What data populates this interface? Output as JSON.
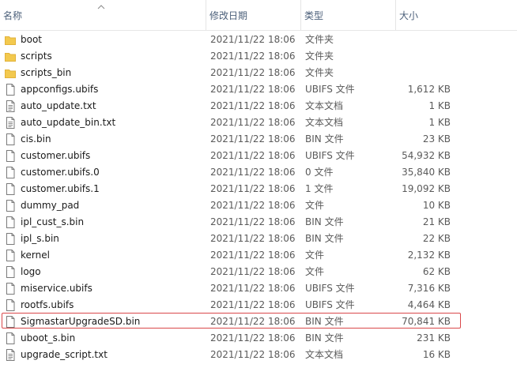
{
  "columns": {
    "name": "名称",
    "date": "修改日期",
    "type": "类型",
    "size": "大小"
  },
  "files": [
    {
      "name": "boot",
      "date": "2021/11/22 18:06",
      "type": "文件夹",
      "size": "",
      "icon": "folder-icon"
    },
    {
      "name": "scripts",
      "date": "2021/11/22 18:06",
      "type": "文件夹",
      "size": "",
      "icon": "folder-icon"
    },
    {
      "name": "scripts_bin",
      "date": "2021/11/22 18:06",
      "type": "文件夹",
      "size": "",
      "icon": "folder-icon"
    },
    {
      "name": "appconfigs.ubifs",
      "date": "2021/11/22 18:06",
      "type": "UBIFS 文件",
      "size": "1,612 KB",
      "icon": "file-icon"
    },
    {
      "name": "auto_update.txt",
      "date": "2021/11/22 18:06",
      "type": "文本文档",
      "size": "1 KB",
      "icon": "text-file-icon"
    },
    {
      "name": "auto_update_bin.txt",
      "date": "2021/11/22 18:06",
      "type": "文本文档",
      "size": "1 KB",
      "icon": "text-file-icon"
    },
    {
      "name": "cis.bin",
      "date": "2021/11/22 18:06",
      "type": "BIN 文件",
      "size": "23 KB",
      "icon": "file-icon"
    },
    {
      "name": "customer.ubifs",
      "date": "2021/11/22 18:06",
      "type": "UBIFS 文件",
      "size": "54,932 KB",
      "icon": "file-icon"
    },
    {
      "name": "customer.ubifs.0",
      "date": "2021/11/22 18:06",
      "type": "0 文件",
      "size": "35,840 KB",
      "icon": "file-icon"
    },
    {
      "name": "customer.ubifs.1",
      "date": "2021/11/22 18:06",
      "type": "1 文件",
      "size": "19,092 KB",
      "icon": "file-icon"
    },
    {
      "name": "dummy_pad",
      "date": "2021/11/22 18:06",
      "type": "文件",
      "size": "10 KB",
      "icon": "file-icon"
    },
    {
      "name": "ipl_cust_s.bin",
      "date": "2021/11/22 18:06",
      "type": "BIN 文件",
      "size": "21 KB",
      "icon": "file-icon"
    },
    {
      "name": "ipl_s.bin",
      "date": "2021/11/22 18:06",
      "type": "BIN 文件",
      "size": "22 KB",
      "icon": "file-icon"
    },
    {
      "name": "kernel",
      "date": "2021/11/22 18:06",
      "type": "文件",
      "size": "2,132 KB",
      "icon": "file-icon"
    },
    {
      "name": "logo",
      "date": "2021/11/22 18:06",
      "type": "文件",
      "size": "62 KB",
      "icon": "file-icon"
    },
    {
      "name": "miservice.ubifs",
      "date": "2021/11/22 18:06",
      "type": "UBIFS 文件",
      "size": "7,316 KB",
      "icon": "file-icon"
    },
    {
      "name": "rootfs.ubifs",
      "date": "2021/11/22 18:06",
      "type": "UBIFS 文件",
      "size": "4,464 KB",
      "icon": "file-icon"
    },
    {
      "name": "SigmastarUpgradeSD.bin",
      "date": "2021/11/22 18:06",
      "type": "BIN 文件",
      "size": "70,841 KB",
      "icon": "file-icon"
    },
    {
      "name": "uboot_s.bin",
      "date": "2021/11/22 18:06",
      "type": "BIN 文件",
      "size": "231 KB",
      "icon": "file-icon"
    },
    {
      "name": "upgrade_script.txt",
      "date": "2021/11/22 18:06",
      "type": "文本文档",
      "size": "16 KB",
      "icon": "text-file-icon"
    }
  ],
  "colors": {
    "folder": "#f0c040",
    "highlight": "#d9484a"
  }
}
